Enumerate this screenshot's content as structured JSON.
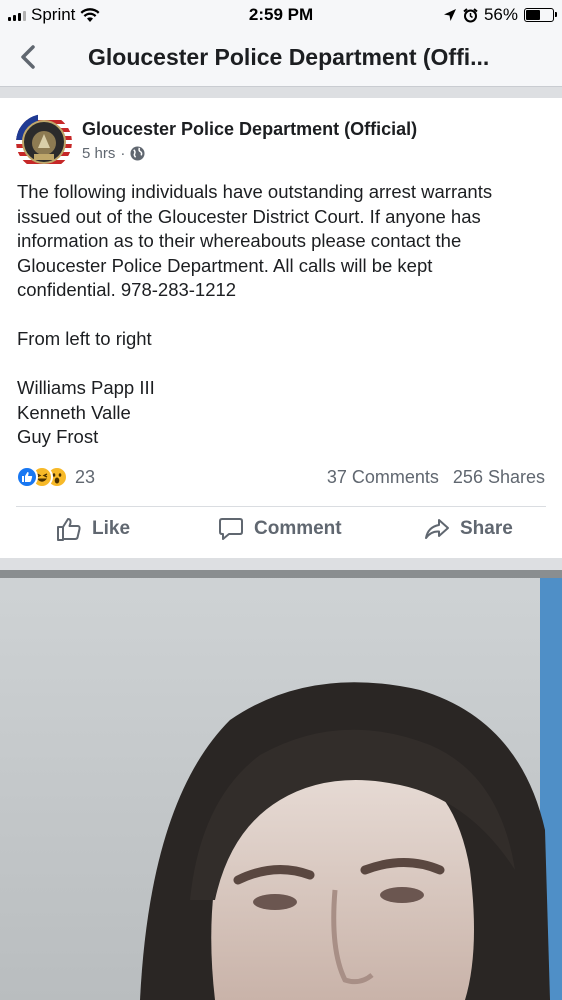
{
  "status_bar": {
    "carrier": "Sprint",
    "time": "2:59 PM",
    "battery_text": "56%",
    "battery_level": 0.56
  },
  "nav": {
    "title": "Gloucester Police Department (Offi...",
    "back_icon": "chevron-left-icon"
  },
  "post": {
    "author": "Gloucester Police Department (Official)",
    "avatar_text_top": "GLOUCESTER",
    "avatar_text_bottom": "POLICE",
    "time": "5 hrs",
    "separator": "·",
    "privacy_icon": "globe-icon",
    "body_lines": [
      "The following individuals have outstanding arrest warrants",
      "issued out of the Gloucester District Court.  If anyone has",
      "information as to their whereabouts please contact the",
      "Gloucester Police Department.  All calls will be kept",
      "confidential. 978-283-1212"
    ],
    "intro": "From left to right",
    "names": [
      "Williams Papp III",
      "Kenneth Valle",
      "Guy Frost"
    ],
    "reactions": [
      "like",
      "haha",
      "wow"
    ],
    "reaction_count": "23",
    "comments": "37 Comments",
    "shares": "256 Shares",
    "actions": {
      "like": "Like",
      "comment": "Comment",
      "share": "Share"
    }
  },
  "colors": {
    "facebook_blue": "#1877f2",
    "reaction_yellow": "#f7b928",
    "text_gray": "#606770"
  }
}
